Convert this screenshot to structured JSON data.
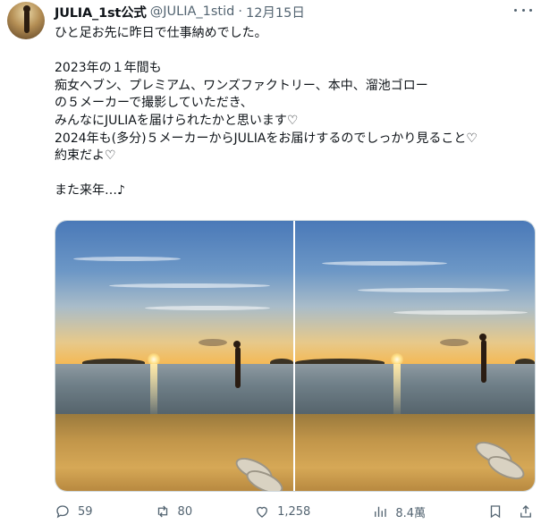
{
  "author": {
    "name": "JULIA_1st公式",
    "handle": "@JULIA_1stid",
    "separator": "·",
    "date": "12月15日"
  },
  "tweet": {
    "text": "ひと足お先に昨日で仕事納めでした。\n\n2023年の１年間も\n痴女ヘブン、プレミアム、ワンズファクトリー、本中、溜池ゴロー\nの５メーカーで撮影していただき、\nみんなにJULIAを届けられたかと思います♡\n2024年も(多分)５メーカーからJULIAをお届けするのでしっかり見ること♡\n約束だよ♡\n\nまた来年…♪"
  },
  "actions": {
    "reply_count": "59",
    "repost_count": "80",
    "like_count": "1,258",
    "view_count": "8.4萬"
  },
  "icons": {
    "more": "more-dots-icon",
    "reply": "reply-icon",
    "repost": "repost-icon",
    "like": "heart-icon",
    "views": "views-chart-icon",
    "bookmark": "bookmark-icon",
    "share": "share-icon"
  },
  "colors": {
    "text": "#0f1419",
    "secondary": "#536471",
    "border": "#cfd9de"
  }
}
